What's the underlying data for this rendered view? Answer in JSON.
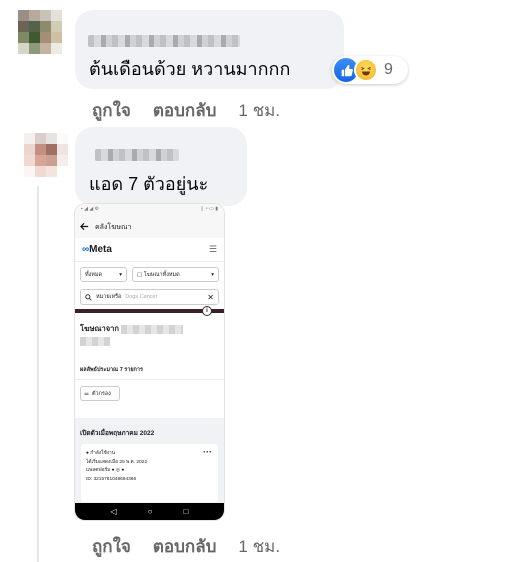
{
  "comment1": {
    "text": "ต้นเดือนด้วย หวานมากกก",
    "reaction_count": "9",
    "reactions": [
      "like-icon",
      "haha-icon"
    ],
    "actions": {
      "like": "ถูกใจ",
      "reply": "ตอบกลับ",
      "time": "1 ชม."
    }
  },
  "comment2": {
    "text": "แอด 7 ตัวอยู่นะ",
    "actions": {
      "like": "ถูกใจ",
      "reply": "ตอบกลับ",
      "time": "1 ชม."
    }
  },
  "attachment": {
    "header": "คลังโฆษณา",
    "brand": "Meta",
    "filter_country": "ทั้งหมด",
    "filter_ad_type": "โฆษณาทั้งหมด",
    "search_label": "หมายเหรือ",
    "search_placeholder": "Dogs Cancer",
    "ads_from": "โฆษณาจาก",
    "results": "ผลลัพธ์ประมาณ 7 รายการ",
    "filter_button": "ตัวกรอง",
    "launched": "เปิดตัวเมื่อพฤษภาคม 2022",
    "card_status": "กำลังใช้งาน",
    "card_started": "ได้เริ่มแสดงเมื่อ 25 พ.ค. 2022",
    "card_platforms": "แพลตฟอร์ม",
    "card_id": "ID: 3215781048694366"
  },
  "colors": {
    "meta_blue": "#0668e1",
    "bubble": "#f0f2f5",
    "muted": "#65676b"
  }
}
